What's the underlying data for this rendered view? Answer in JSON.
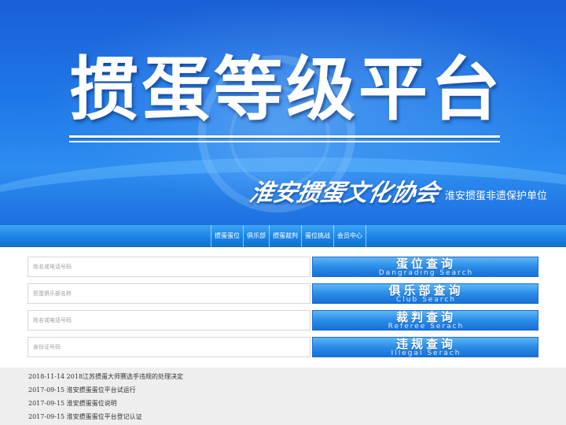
{
  "banner": {
    "title": "掼蛋等级平台",
    "org_name": "淮安掼蛋文化协会",
    "org_subtitle": "淮安掼蛋非遗保护单位"
  },
  "nav": {
    "items": [
      "掼蛋蛋位",
      "俱乐部",
      "掼蛋裁判",
      "蛋位挑战",
      "会员中心"
    ]
  },
  "search": {
    "rows": [
      {
        "placeholder": "姓名或电话号码",
        "button_cn": "蛋位查询",
        "button_en": "Dangrading Search"
      },
      {
        "placeholder": "掼蛋俱乐部名称",
        "button_cn": "俱乐部查询",
        "button_en": "Club Search"
      },
      {
        "placeholder": "姓名或电话号码",
        "button_cn": "裁判查询",
        "button_en": "Referee Serach"
      },
      {
        "placeholder": "身份证号码",
        "button_cn": "违规查询",
        "button_en": "Illegal Serach"
      }
    ]
  },
  "news": {
    "items": [
      "2018-11-14 2018江苏掼蛋大师赛选手违规的处理决定",
      "2017-09-15 淮安掼蛋蛋位平台试运行",
      "2017-09-15 淮安掼蛋蛋位说明",
      "2017-09-15 淮安掼蛋蛋位平台登记认证"
    ]
  },
  "colors": {
    "banner_top": "#1a5fd6",
    "banner_bottom": "#2d8df0",
    "button_blue": "#2a8ce8",
    "news_bg": "#eeeeee"
  }
}
